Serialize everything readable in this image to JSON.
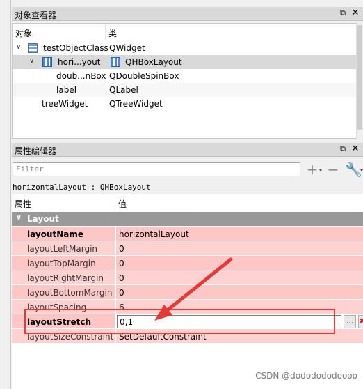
{
  "object_inspector": {
    "title": "对象查看器",
    "col_object": "对象",
    "col_class": "类",
    "rows": [
      {
        "name": "testObjectClass",
        "cls": "QWidget"
      },
      {
        "name": "hori...yout",
        "cls": "QHBoxLayout"
      },
      {
        "name": "doub...nBox",
        "cls": "QDoubleSpinBox"
      },
      {
        "name": "label",
        "cls": "QLabel"
      },
      {
        "name": "treeWidget",
        "cls": "QTreeWidget"
      }
    ]
  },
  "property_editor": {
    "title": "属性编辑器",
    "filter_placeholder": "Filter",
    "class_line": "horizontalLayout : QHBoxLayout",
    "col_property": "属性",
    "col_value": "值",
    "group": "Layout",
    "props": [
      {
        "name": "layoutName",
        "value": "horizontalLayout"
      },
      {
        "name": "layoutLeftMargin",
        "value": "0"
      },
      {
        "name": "layoutTopMargin",
        "value": "0"
      },
      {
        "name": "layoutRightMargin",
        "value": "0"
      },
      {
        "name": "layoutBottomMargin",
        "value": "0"
      },
      {
        "name": "layoutSpacing",
        "value": "6"
      },
      {
        "name": "layoutStretch",
        "value": "0,1"
      },
      {
        "name": "layoutSizeConstraint",
        "value": "SetDefaultConstraint"
      }
    ],
    "ellipsis_label": "..."
  },
  "watermark": "CSDN @dododododoooo",
  "colors": {
    "highlight": "#e53935",
    "row_pink": "#ffc6c6",
    "group_gray": "#999999"
  }
}
